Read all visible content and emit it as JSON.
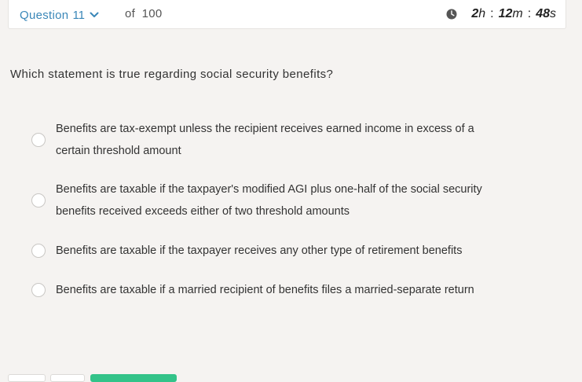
{
  "header": {
    "question_label": "Question",
    "question_number": "11",
    "of_label": "of",
    "total": "100",
    "timer": {
      "hours": "2",
      "hours_unit": "h",
      "minutes": "12",
      "minutes_unit": "m",
      "seconds": "48",
      "seconds_unit": "s",
      "separator": ":"
    }
  },
  "question": {
    "text": "Which statement is true regarding social security benefits?"
  },
  "options": [
    {
      "line1": "Benefits are tax-exempt unless the recipient receives earned income in excess of a",
      "line2": "certain threshold amount"
    },
    {
      "line1": "Benefits are taxable if the taxpayer's modified AGI plus one-half of the social security",
      "line2": "benefits received exceeds either of two threshold amounts"
    },
    {
      "line1": "Benefits are taxable if the taxpayer receives any other type of retirement benefits"
    },
    {
      "line1": "Benefits are taxable if a married recipient of benefits files a married-separate return"
    }
  ],
  "colors": {
    "accent": "#3a87b8",
    "submit_green": "#33c389"
  }
}
